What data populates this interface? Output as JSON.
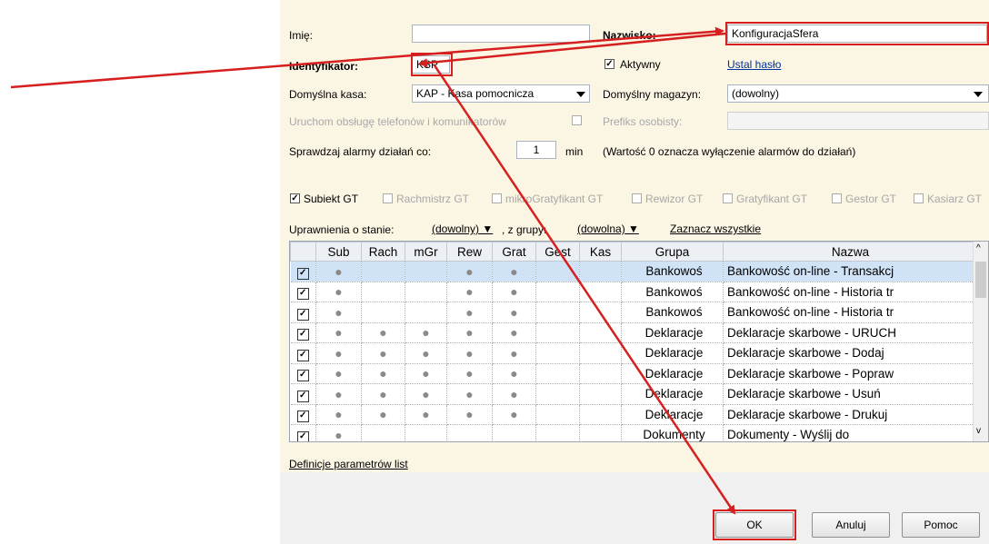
{
  "form": {
    "imie_label": "Imię:",
    "imie_value": "",
    "nazwisko_label": "Nazwisko:",
    "nazwisko_value": "KonfiguracjaSfera",
    "identyfikator_label": "Identyfikator:",
    "identyfikator_value": "KSP",
    "aktywny_label": "Aktywny",
    "ustal_haslo_label": "Ustal hasło",
    "kasa_label": "Domyślna kasa:",
    "kasa_value": "KAP - Kasa pomocnicza",
    "magazyn_label": "Domyślny magazyn:",
    "magazyn_value": "(dowolny)",
    "telefon_label": "Uruchom obsługę telefonów i komunikatorów",
    "prefiks_label": "Prefiks osobisty:",
    "alarmy_label": "Sprawdzaj alarmy działań co:",
    "alarmy_value": "1",
    "alarmy_unit": "min",
    "alarmy_note": "(Wartość 0 oznacza wyłączenie alarmów do działań)"
  },
  "modules": [
    {
      "label": "Subiekt GT",
      "checked": true
    },
    {
      "label": "Rachmistrz GT",
      "checked": false
    },
    {
      "label": "mikroGratyfikant GT",
      "checked": false
    },
    {
      "label": "Rewizor GT",
      "checked": false
    },
    {
      "label": "Gratyfikant GT",
      "checked": false
    },
    {
      "label": "Gestor GT",
      "checked": false
    },
    {
      "label": "Kasiarz GT",
      "checked": false
    }
  ],
  "filters": {
    "uprawnienia_label": "Uprawnienia o stanie:",
    "stan_value": "(dowolny)",
    "grupy_label": ", z grupy:",
    "grupa_value": "(dowolna)",
    "zaznacz_label": "Zaznacz wszystkie"
  },
  "grid": {
    "headers": [
      "",
      "Sub",
      "Rach",
      "mGr",
      "Rew",
      "Grat",
      "Gest",
      "Kas",
      "Grupa",
      "Nazwa"
    ],
    "rows": [
      {
        "grupa": "Bankowoś",
        "nazwa": "Bankowość on-line - Transakcj",
        "marks": [
          1,
          0,
          0,
          1,
          1,
          0,
          0
        ]
      },
      {
        "grupa": "Bankowoś",
        "nazwa": "Bankowość on-line - Historia tr",
        "marks": [
          1,
          0,
          0,
          1,
          1,
          0,
          0
        ]
      },
      {
        "grupa": "Bankowoś",
        "nazwa": "Bankowość on-line - Historia tr",
        "marks": [
          1,
          0,
          0,
          1,
          1,
          0,
          0
        ]
      },
      {
        "grupa": "Deklaracje",
        "nazwa": "Deklaracje skarbowe - URUCH",
        "marks": [
          1,
          1,
          1,
          1,
          1,
          0,
          0
        ]
      },
      {
        "grupa": "Deklaracje",
        "nazwa": "Deklaracje skarbowe - Dodaj",
        "marks": [
          1,
          1,
          1,
          1,
          1,
          0,
          0
        ]
      },
      {
        "grupa": "Deklaracje",
        "nazwa": "Deklaracje skarbowe - Popraw",
        "marks": [
          1,
          1,
          1,
          1,
          1,
          0,
          0
        ]
      },
      {
        "grupa": "Deklaracje",
        "nazwa": "Deklaracje skarbowe - Usuń",
        "marks": [
          1,
          1,
          1,
          1,
          1,
          0,
          0
        ]
      },
      {
        "grupa": "Deklaracje",
        "nazwa": "Deklaracje skarbowe - Drukuj",
        "marks": [
          1,
          1,
          1,
          1,
          1,
          0,
          0
        ]
      },
      {
        "grupa": "Dokumenty",
        "nazwa": "Dokumenty - Wyślij do",
        "marks": [
          1,
          0,
          0,
          0,
          0,
          0,
          0
        ]
      }
    ]
  },
  "definicje_label": "Definicje parametrów list",
  "buttons": {
    "ok": "OK",
    "anuluj": "Anuluj",
    "pomoc": "Pomoc"
  },
  "colors": {
    "annotation": "#d62020",
    "selected_row": "#cfe2f6",
    "dialog_bg": "#fbf5e4"
  }
}
